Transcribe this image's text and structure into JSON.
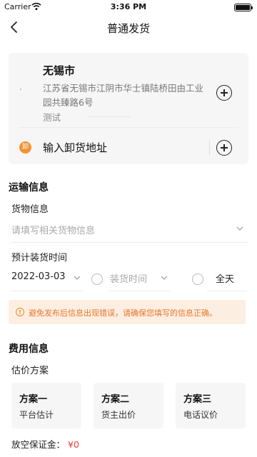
{
  "status_bar": {
    "carrier": "Carrier",
    "time": "3:36 PM"
  },
  "nav": {
    "title": "普通发货"
  },
  "address_card": {
    "city": "无锡市",
    "detail": "江苏省无锡市江阴市华士镇陆桥田由工业园共臻路6号",
    "contact": "测试",
    "unload_badge": "卸",
    "unload_label": "输入卸货地址"
  },
  "transport": {
    "section_title": "运输信息",
    "cargo_label": "货物信息",
    "cargo_placeholder": "请填写相关货物信息",
    "load_time_label": "预计装货时间",
    "date_value": "2022-03-03",
    "time_placeholder": "装货时间",
    "all_day": "全天"
  },
  "notice": {
    "icon": "!",
    "text": "避免发布后信息出现错误，请确保您填写的信息正确。"
  },
  "fees": {
    "section_title": "费用信息",
    "estimate_label": "估价方案",
    "plans": [
      {
        "name": "方案一",
        "desc": "平台估计"
      },
      {
        "name": "方案二",
        "desc": "货主出价"
      },
      {
        "name": "方案三",
        "desc": "电话议价"
      }
    ],
    "deposit_label": "放空保证金：",
    "deposit_amount": "¥0"
  },
  "colors": {
    "accent_orange": "#f29432",
    "notice_bg": "#fdeee2",
    "notice_text": "#e8782a",
    "price_red": "#e83b3b"
  }
}
